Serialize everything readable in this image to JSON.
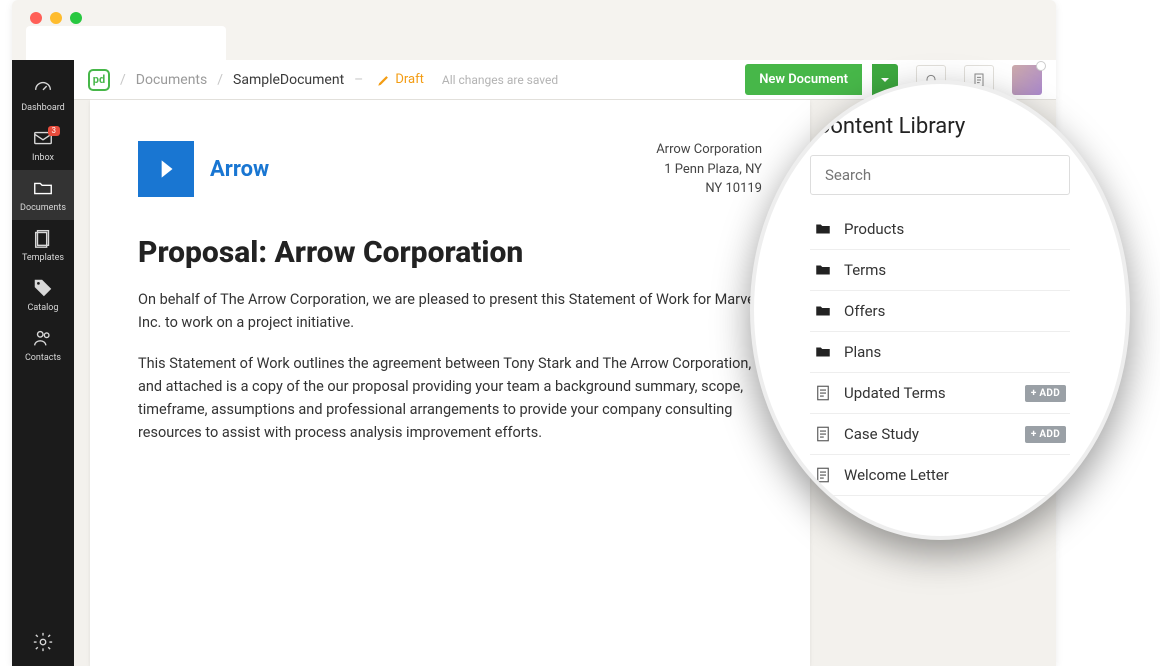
{
  "sidebar": {
    "items": [
      {
        "label": "Dashboard"
      },
      {
        "label": "Inbox",
        "badge": "3"
      },
      {
        "label": "Documents"
      },
      {
        "label": "Templates"
      },
      {
        "label": "Catalog"
      },
      {
        "label": "Contacts"
      }
    ]
  },
  "breadcrumb": {
    "root": "Documents",
    "current": "SampleDocument",
    "dash": "–"
  },
  "status": {
    "label": "Draft"
  },
  "save_note": "All changes are saved",
  "header": {
    "new_document": "New Document"
  },
  "document": {
    "brand_name": "Arrow",
    "addr1": "Arrow Corporation",
    "addr2": "1 Penn Plaza, NY",
    "addr3": "NY 10119",
    "title": "Proposal: Arrow Corporation",
    "p1": "On behalf of The Arrow Corporation, we are pleased to present this Statement of Work for Marvel Inc. to work on a project initiative.",
    "p2": "This Statement of Work outlines the agreement between Tony Stark and The Arrow Corporation, and attached is a copy of the our proposal providing your team a background summary, scope, timeframe, assumptions and professional arrangements to provide your company consulting resources to assist with process analysis improvement efforts."
  },
  "library": {
    "title": "Content Library",
    "search_placeholder": "Search",
    "items": [
      {
        "type": "folder",
        "label": "Products"
      },
      {
        "type": "folder",
        "label": "Terms"
      },
      {
        "type": "folder",
        "label": "Offers"
      },
      {
        "type": "folder",
        "label": "Plans"
      },
      {
        "type": "doc",
        "label": "Updated Terms",
        "add": "+ ADD"
      },
      {
        "type": "doc",
        "label": "Case Study",
        "add": "+ ADD"
      },
      {
        "type": "doc",
        "label": "Welcome Letter"
      }
    ]
  }
}
